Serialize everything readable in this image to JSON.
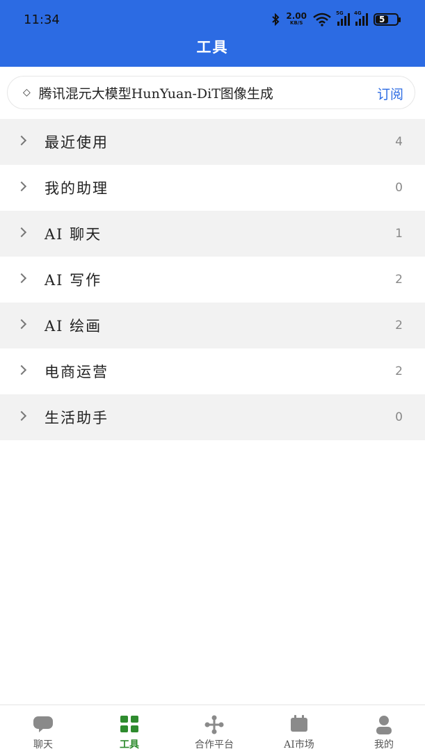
{
  "status": {
    "time": "11:34",
    "net_speed": "2.00",
    "net_unit": "KB/S",
    "sig1_tag": "5G",
    "sig2_tag": "4G",
    "battery": "5"
  },
  "header": {
    "title": "工具"
  },
  "notice": {
    "text": "腾讯混元大模型HunYuan-DiT图像生成",
    "subscribe": "订阅"
  },
  "categories": [
    {
      "label": "最近使用",
      "count": "4"
    },
    {
      "label": "我的助理",
      "count": "0"
    },
    {
      "label": "AI 聊天",
      "count": "1"
    },
    {
      "label": "AI 写作",
      "count": "2"
    },
    {
      "label": "AI 绘画",
      "count": "2"
    },
    {
      "label": "电商运营",
      "count": "2"
    },
    {
      "label": "生活助手",
      "count": "0"
    }
  ],
  "tabs": [
    {
      "label": "聊天",
      "icon": "chat-bubble-icon"
    },
    {
      "label": "工具",
      "icon": "grid-icon",
      "active": true
    },
    {
      "label": "合作平台",
      "icon": "move-arrows-icon"
    },
    {
      "label": "AI市场",
      "icon": "calendar-icon"
    },
    {
      "label": "我的",
      "icon": "person-icon"
    }
  ],
  "colors": {
    "header": "#2c6be3",
    "active_tab": "#2e8b2e",
    "icon_gray": "#8a8a8a"
  }
}
